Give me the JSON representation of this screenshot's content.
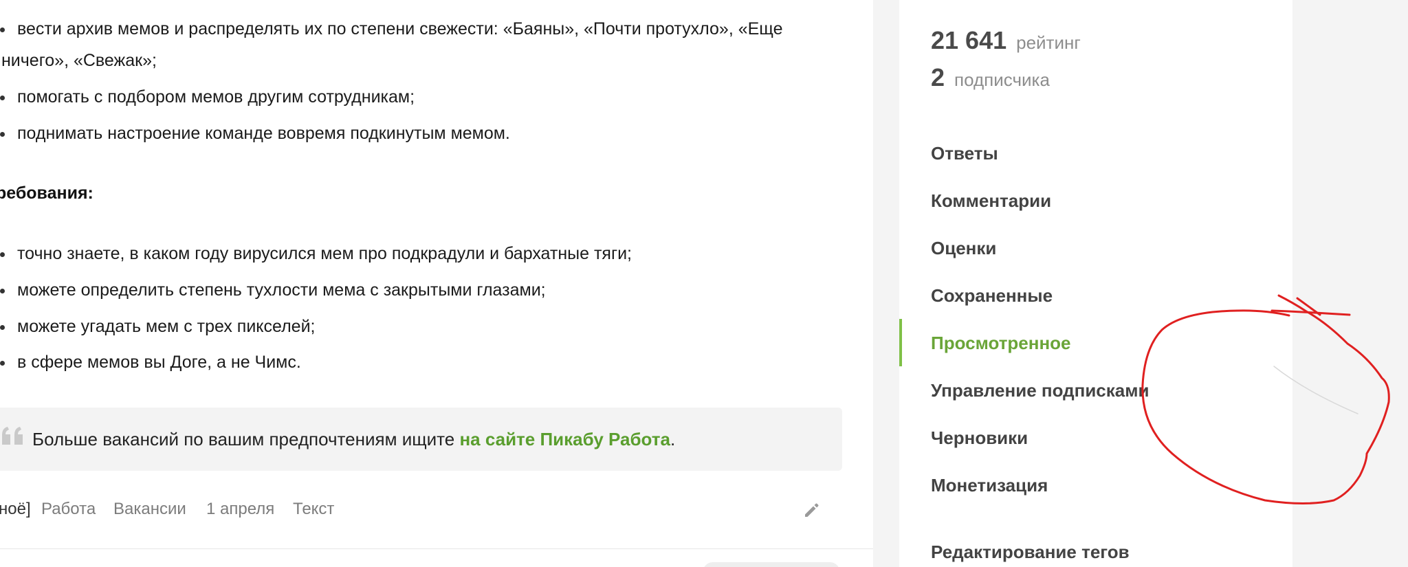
{
  "article": {
    "list_a": [
      {
        "text": "вести архив мемов и распределять их по степени свежести: «Баяны», «Почти протухло», «Еще"
      },
      {
        "text": "помогать с подбором мемов другим сотрудникам;"
      },
      {
        "text": "поднимать настроение команде вовремя подкинутым мемом."
      }
    ],
    "list_a_wrap": "ничего», «Свежак»;",
    "heading": "ребования:",
    "list_b": [
      {
        "text": "точно знаете, в каком году вирусился мем про подкрадули и бархатные тяги;"
      },
      {
        "text": "можете определить степень тухлости мема с закрытыми глазами;"
      },
      {
        "text": "можете угадать мем с трех пикселей;"
      },
      {
        "text": "в сфере мемов вы Доге, а не Чимс."
      }
    ],
    "quote": {
      "text": "Больше вакансий по вашим предпочтениям ищите ",
      "link": "на сайте Пикабу Работа",
      "tail": "."
    },
    "tags": [
      "ноё]",
      "Работа",
      "Вакансии",
      "1 апреля",
      "Текст"
    ]
  },
  "sidebar": {
    "rating": {
      "value": "21 641",
      "label": "рейтинг"
    },
    "subscribers": {
      "value": "2",
      "label": "подписчика"
    },
    "menu": [
      {
        "label": "Ответы",
        "active": false
      },
      {
        "label": "Комментарии",
        "active": false
      },
      {
        "label": "Оценки",
        "active": false
      },
      {
        "label": "Сохраненные",
        "active": false
      },
      {
        "label": "Просмотренное",
        "active": true
      },
      {
        "label": "Управление подписками",
        "active": false
      },
      {
        "label": "Черновики",
        "active": false
      },
      {
        "label": "Монетизация",
        "active": false
      },
      {
        "label": "Редактирование тегов",
        "active": false
      }
    ]
  },
  "colors": {
    "accent": "#6aa538",
    "link": "#5a9e2e",
    "annotation": "#e02020"
  },
  "icons": {
    "quote": "quote-icon",
    "edit": "pencil-icon"
  }
}
